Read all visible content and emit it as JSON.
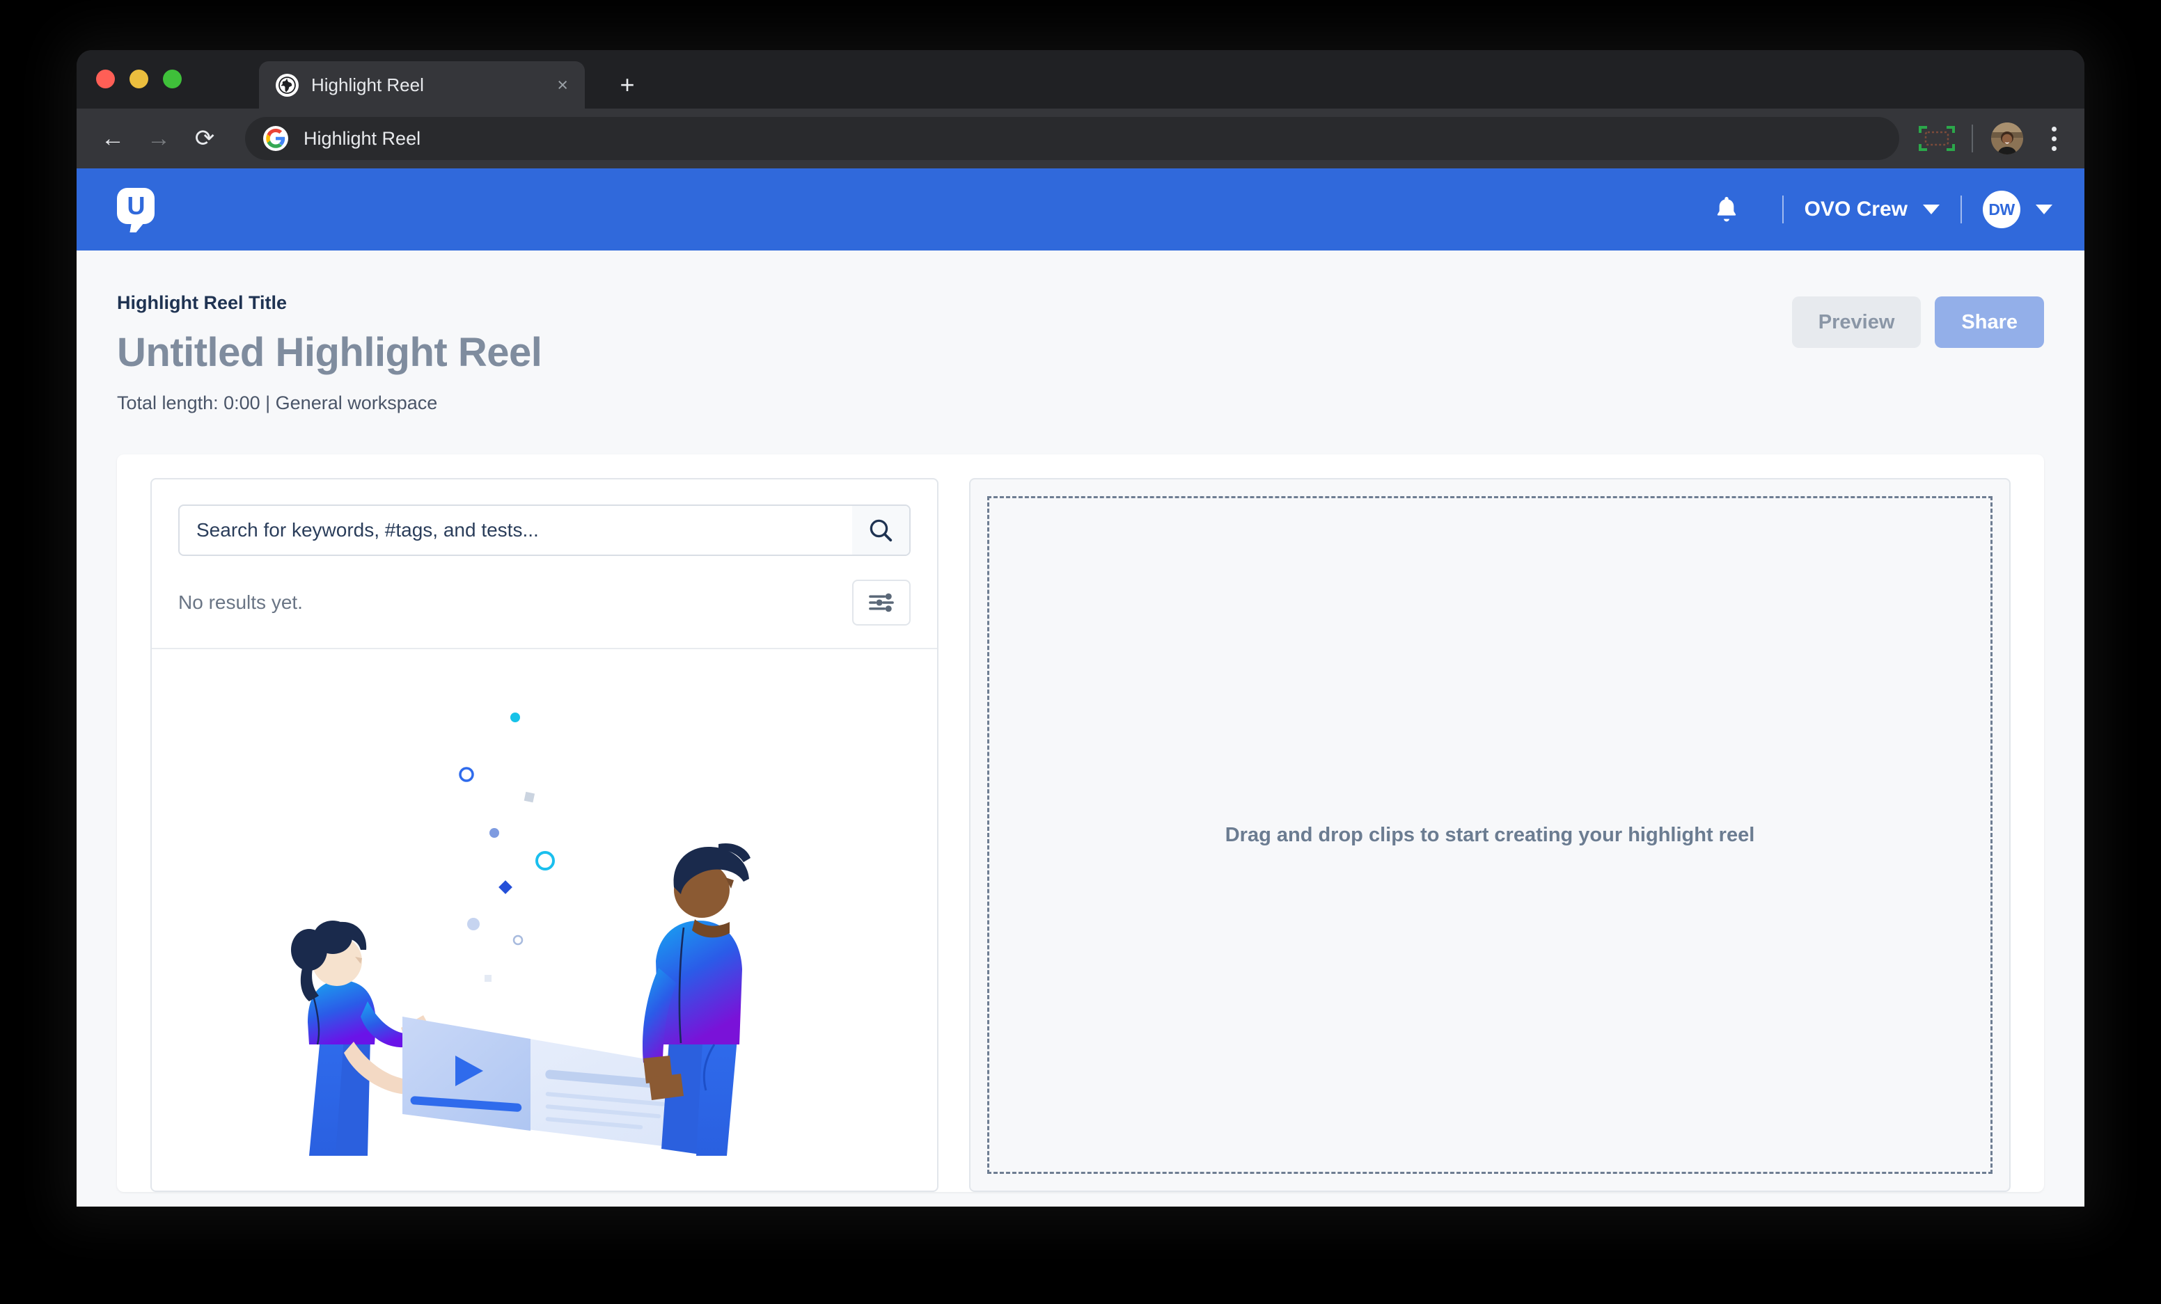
{
  "browser": {
    "tab": {
      "title": "Highlight Reel",
      "favicon": "globe-icon",
      "close_label": "×"
    },
    "new_tab_label": "+",
    "nav": {
      "back": "←",
      "forward": "→",
      "reload": "⟳"
    },
    "omnibox": {
      "text": "Highlight Reel",
      "favicon": "google-g-icon"
    },
    "right_icons": [
      "capture-icon",
      "profile-avatar",
      "kebab-menu-icon"
    ]
  },
  "app_header": {
    "logo_letter": "U",
    "logo_name": "usertesting-logo",
    "notifications_icon": "bell-icon",
    "workspace": "OVO Crew",
    "workspace_caret": "chevron-down-icon",
    "user_initials": "DW",
    "user_caret": "chevron-down-icon"
  },
  "page": {
    "eyebrow": "Highlight Reel Title",
    "title": "Untitled Highlight Reel",
    "meta": "Total length: 0:00 | General workspace",
    "actions": {
      "preview_label": "Preview",
      "share_label": "Share"
    }
  },
  "search_panel": {
    "placeholder": "Search for keywords, #tags, and tests...",
    "value": "",
    "search_icon": "search-icon",
    "results_text": "No results yet.",
    "filter_icon": "filter-sliders-icon"
  },
  "drop_zone": {
    "text": "Drag and drop clips to start creating your highlight reel"
  },
  "colors": {
    "header_blue": "#3069DB",
    "page_bg": "#F7F8FA",
    "title_grey": "#7F8C9E",
    "eyebrow_navy": "#1F3352",
    "share_blue": "#93AFE9",
    "preview_grey": "#E7EAEE",
    "dashed_border": "#6E7D92"
  }
}
